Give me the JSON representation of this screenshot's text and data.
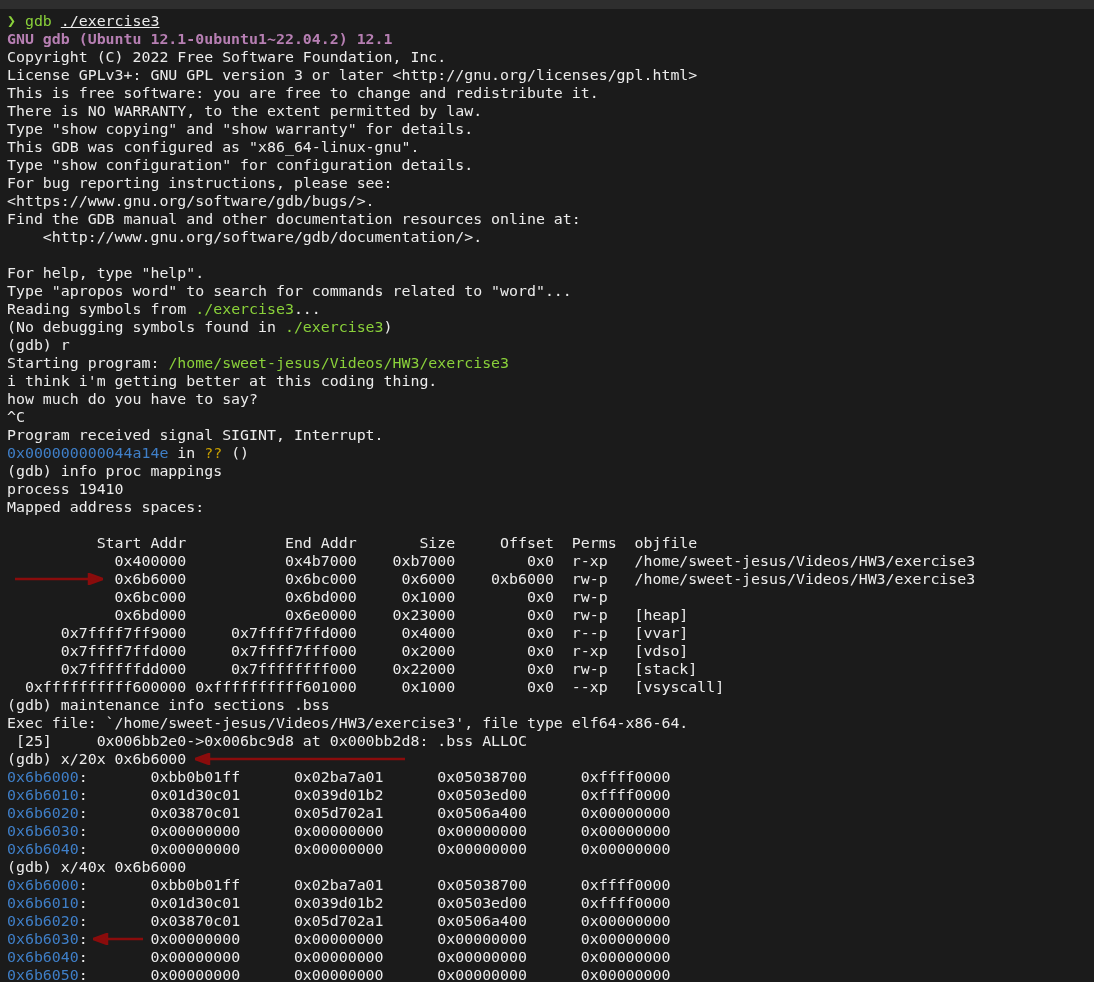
{
  "terminal": {
    "lines": [
      {
        "kind": "plain",
        "segments": [
          {
            "text": "❯",
            "kind": "prompt"
          },
          {
            "text": " gdb ",
            "kind": "green"
          },
          {
            "text": "./exercise3",
            "kind": "underline"
          }
        ]
      },
      {
        "kind": "plain",
        "segments": [
          {
            "text": "GNU gdb (Ubuntu 12.1-0ubuntu1~22.04.2) 12.1",
            "kind": "heading"
          }
        ]
      },
      {
        "kind": "plain",
        "segments": [
          {
            "text": "Copyright (C) 2022 Free Software Foundation, Inc.",
            "kind": "plain"
          }
        ]
      },
      {
        "kind": "plain",
        "segments": [
          {
            "text": "License GPLv3+: GNU GPL version 3 or later <http://gnu.org/licenses/gpl.html>",
            "kind": "plain"
          }
        ]
      },
      {
        "kind": "plain",
        "segments": [
          {
            "text": "This is free software: you are free to change and redistribute it.",
            "kind": "plain"
          }
        ]
      },
      {
        "kind": "plain",
        "segments": [
          {
            "text": "There is NO WARRANTY, to the extent permitted by law.",
            "kind": "plain"
          }
        ]
      },
      {
        "kind": "plain",
        "segments": [
          {
            "text": "Type \"show copying\" and \"show warranty\" for details.",
            "kind": "plain"
          }
        ]
      },
      {
        "kind": "plain",
        "segments": [
          {
            "text": "This GDB was configured as \"x86_64-linux-gnu\".",
            "kind": "plain"
          }
        ]
      },
      {
        "kind": "plain",
        "segments": [
          {
            "text": "Type \"show configuration\" for configuration details.",
            "kind": "plain"
          }
        ]
      },
      {
        "kind": "plain",
        "segments": [
          {
            "text": "For bug reporting instructions, please see:",
            "kind": "plain"
          }
        ]
      },
      {
        "kind": "plain",
        "segments": [
          {
            "text": "<https://www.gnu.org/software/gdb/bugs/>.",
            "kind": "plain"
          }
        ]
      },
      {
        "kind": "plain",
        "segments": [
          {
            "text": "Find the GDB manual and other documentation resources online at:",
            "kind": "plain"
          }
        ]
      },
      {
        "kind": "plain",
        "segments": [
          {
            "text": "    <http://www.gnu.org/software/gdb/documentation/>.",
            "kind": "plain"
          }
        ]
      },
      {
        "kind": "blank"
      },
      {
        "kind": "plain",
        "segments": [
          {
            "text": "For help, type \"help\".",
            "kind": "plain"
          }
        ]
      },
      {
        "kind": "plain",
        "segments": [
          {
            "text": "Type \"apropos word\" to search for commands related to \"word\"...",
            "kind": "plain"
          }
        ]
      },
      {
        "kind": "plain",
        "segments": [
          {
            "text": "Reading symbols from ",
            "kind": "plain"
          },
          {
            "text": "./exercise3",
            "kind": "green"
          },
          {
            "text": "...",
            "kind": "plain"
          }
        ]
      },
      {
        "kind": "plain",
        "segments": [
          {
            "text": "(No debugging symbols found in ",
            "kind": "plain"
          },
          {
            "text": "./exercise3",
            "kind": "green"
          },
          {
            "text": ")",
            "kind": "plain"
          }
        ]
      },
      {
        "kind": "plain",
        "segments": [
          {
            "text": "(gdb) r",
            "kind": "plain"
          }
        ]
      },
      {
        "kind": "plain",
        "segments": [
          {
            "text": "Starting program: ",
            "kind": "plain"
          },
          {
            "text": "/home/sweet-jesus/Videos/HW3/exercise3",
            "kind": "green"
          }
        ]
      },
      {
        "kind": "plain",
        "segments": [
          {
            "text": "i think i'm getting better at this coding thing.",
            "kind": "plain"
          }
        ]
      },
      {
        "kind": "plain",
        "segments": [
          {
            "text": "how much do you have to say?",
            "kind": "plain"
          }
        ]
      },
      {
        "kind": "plain",
        "segments": [
          {
            "text": "^C",
            "kind": "plain"
          }
        ]
      },
      {
        "kind": "plain",
        "segments": [
          {
            "text": "Program received signal SIGINT, Interrupt.",
            "kind": "plain"
          }
        ]
      },
      {
        "kind": "plain",
        "segments": [
          {
            "text": "0x000000000044a14e",
            "kind": "blue"
          },
          {
            "text": " in ",
            "kind": "plain"
          },
          {
            "text": "??",
            "kind": "yellow"
          },
          {
            "text": " ()",
            "kind": "plain"
          }
        ]
      },
      {
        "kind": "plain",
        "segments": [
          {
            "text": "(gdb) info proc mappings",
            "kind": "plain"
          }
        ]
      },
      {
        "kind": "plain",
        "segments": [
          {
            "text": "process 19410",
            "kind": "plain"
          }
        ]
      },
      {
        "kind": "plain",
        "segments": [
          {
            "text": "Mapped address spaces:",
            "kind": "plain"
          }
        ]
      },
      {
        "kind": "blank"
      },
      {
        "kind": "plain",
        "segments": [
          {
            "text": "          Start Addr           End Addr       Size     Offset  Perms  objfile",
            "kind": "plain"
          }
        ]
      },
      {
        "kind": "plain",
        "segments": [
          {
            "text": "            0x400000           0x4b7000    0xb7000        0x0  r-xp   /home/sweet-jesus/Videos/HW3/exercise3",
            "kind": "plain"
          }
        ]
      },
      {
        "kind": "gutter",
        "segments": [
          {
            "text": "            0x6b6000           0x6bc000     0x6000    0xb6000  rw-p   /home/sweet-jesus/Videos/HW3/exercise3",
            "kind": "plain"
          }
        ]
      },
      {
        "kind": "plain",
        "segments": [
          {
            "text": "            0x6bc000           0x6bd000     0x1000        0x0  rw-p",
            "kind": "plain"
          }
        ]
      },
      {
        "kind": "plain",
        "segments": [
          {
            "text": "            0x6bd000           0x6e0000    0x23000        0x0  rw-p   [heap]",
            "kind": "plain"
          }
        ]
      },
      {
        "kind": "plain",
        "segments": [
          {
            "text": "      0x7ffff7ff9000     0x7ffff7ffd000     0x4000        0x0  r--p   [vvar]",
            "kind": "plain"
          }
        ]
      },
      {
        "kind": "plain",
        "segments": [
          {
            "text": "      0x7ffff7ffd000     0x7ffff7fff000     0x2000        0x0  r-xp   [vdso]",
            "kind": "plain"
          }
        ]
      },
      {
        "kind": "plain",
        "segments": [
          {
            "text": "      0x7ffffffdd000     0x7ffffffff000    0x22000        0x0  rw-p   [stack]",
            "kind": "plain"
          }
        ]
      },
      {
        "kind": "plain",
        "segments": [
          {
            "text": "  0xffffffffff600000 0xffffffffff601000     0x1000        0x0  --xp   [vsyscall]",
            "kind": "plain"
          }
        ]
      },
      {
        "kind": "plain",
        "segments": [
          {
            "text": "(gdb) maintenance info sections .bss",
            "kind": "plain"
          }
        ]
      },
      {
        "kind": "plain",
        "segments": [
          {
            "text": "Exec file: `/home/sweet-jesus/Videos/HW3/exercise3', file type elf64-x86-64.",
            "kind": "plain"
          }
        ]
      },
      {
        "kind": "plain",
        "segments": [
          {
            "text": " [25]     0x006bb2e0->0x006bc9d8 at 0x000bb2d8: .bss ALLOC",
            "kind": "plain"
          }
        ]
      },
      {
        "kind": "long",
        "segments": [
          {
            "text": "(gdb) x/20x 0x6b6000",
            "kind": "plain"
          }
        ]
      },
      {
        "kind": "plain",
        "segments": [
          {
            "text": "0x6b6000",
            "kind": "blue"
          },
          {
            "text": ":       0xbb0b01ff      0x02ba7a01      0x05038700      0xffff0000",
            "kind": "plain"
          }
        ]
      },
      {
        "kind": "plain",
        "segments": [
          {
            "text": "0x6b6010",
            "kind": "blue"
          },
          {
            "text": ":       0x01d30c01      0x039d01b2      0x0503ed00      0xffff0000",
            "kind": "plain"
          }
        ]
      },
      {
        "kind": "plain",
        "segments": [
          {
            "text": "0x6b6020",
            "kind": "blue"
          },
          {
            "text": ":       0x03870c01      0x05d702a1      0x0506a400      0x00000000",
            "kind": "plain"
          }
        ]
      },
      {
        "kind": "plain",
        "segments": [
          {
            "text": "0x6b6030",
            "kind": "blue"
          },
          {
            "text": ":       0x00000000      0x00000000      0x00000000      0x00000000",
            "kind": "plain"
          }
        ]
      },
      {
        "kind": "plain",
        "segments": [
          {
            "text": "0x6b6040",
            "kind": "blue"
          },
          {
            "text": ":       0x00000000      0x00000000      0x00000000      0x00000000",
            "kind": "plain"
          }
        ]
      },
      {
        "kind": "plain",
        "segments": [
          {
            "text": "(gdb) x/40x 0x6b6000",
            "kind": "plain"
          }
        ]
      },
      {
        "kind": "plain",
        "segments": [
          {
            "text": "0x6b6000",
            "kind": "blue"
          },
          {
            "text": ":       0xbb0b01ff      0x02ba7a01      0x05038700      0xffff0000",
            "kind": "plain"
          }
        ]
      },
      {
        "kind": "plain",
        "segments": [
          {
            "text": "0x6b6010",
            "kind": "blue"
          },
          {
            "text": ":       0x01d30c01      0x039d01b2      0x0503ed00      0xffff0000",
            "kind": "plain"
          }
        ]
      },
      {
        "kind": "plain",
        "segments": [
          {
            "text": "0x6b6020",
            "kind": "blue"
          },
          {
            "text": ":       0x03870c01      0x05d702a1      0x0506a400      0x00000000",
            "kind": "plain"
          }
        ]
      },
      {
        "kind": "short",
        "segments": [
          {
            "text": "0x6b6030",
            "kind": "blue"
          },
          {
            "text": ":       0x00000000      0x00000000      0x00000000      0x00000000",
            "kind": "plain"
          }
        ]
      },
      {
        "kind": "plain",
        "segments": [
          {
            "text": "0x6b6040",
            "kind": "blue"
          },
          {
            "text": ":       0x00000000      0x00000000      0x00000000      0x00000000",
            "kind": "plain"
          }
        ]
      },
      {
        "kind": "plain",
        "segments": [
          {
            "text": "0x6b6050",
            "kind": "blue"
          },
          {
            "text": ":       0x00000000      0x00000000      0x00000000      0x00000000",
            "kind": "plain"
          }
        ]
      }
    ]
  }
}
